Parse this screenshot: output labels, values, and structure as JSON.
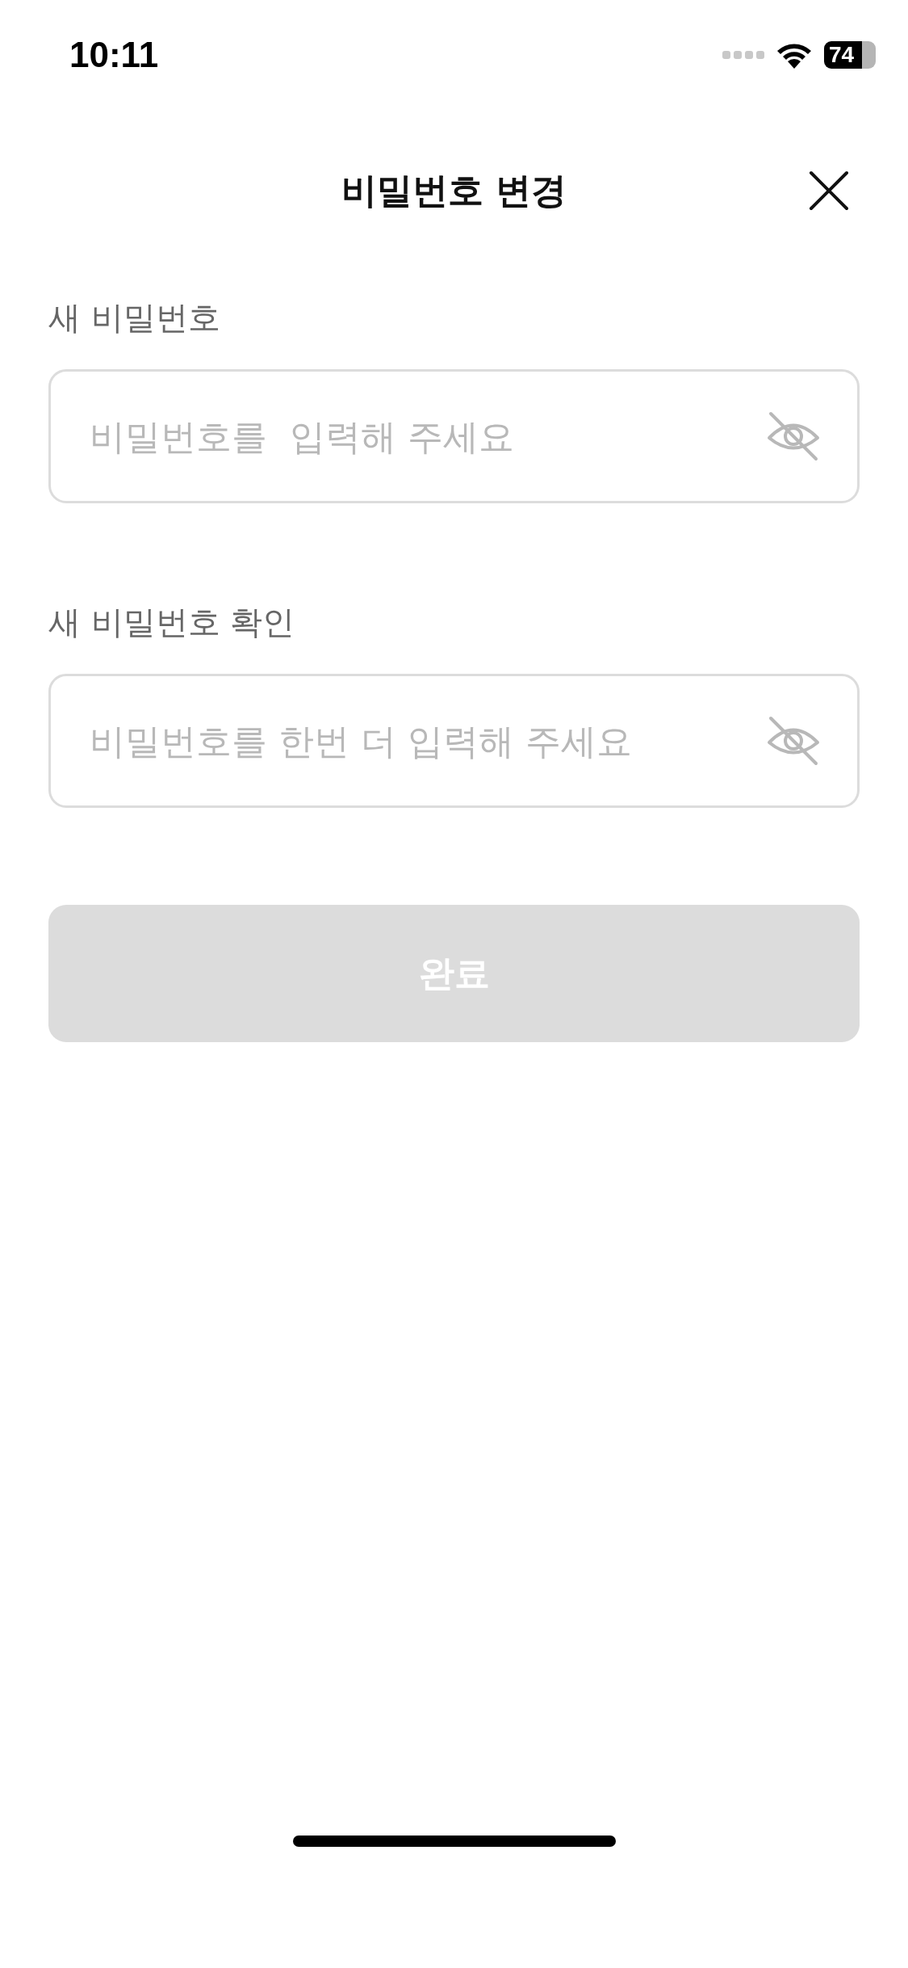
{
  "status_bar": {
    "time": "10:11",
    "battery": "74"
  },
  "header": {
    "title": "비밀번호 변경"
  },
  "fields": [
    {
      "label": "새 비밀번호",
      "placeholder": "비밀번호를  입력해 주세요"
    },
    {
      "label": "새 비밀번호 확인",
      "placeholder": "비밀번호를 한번 더 입력해 주세요"
    }
  ],
  "submit": {
    "label": "완료",
    "disabled": true
  }
}
